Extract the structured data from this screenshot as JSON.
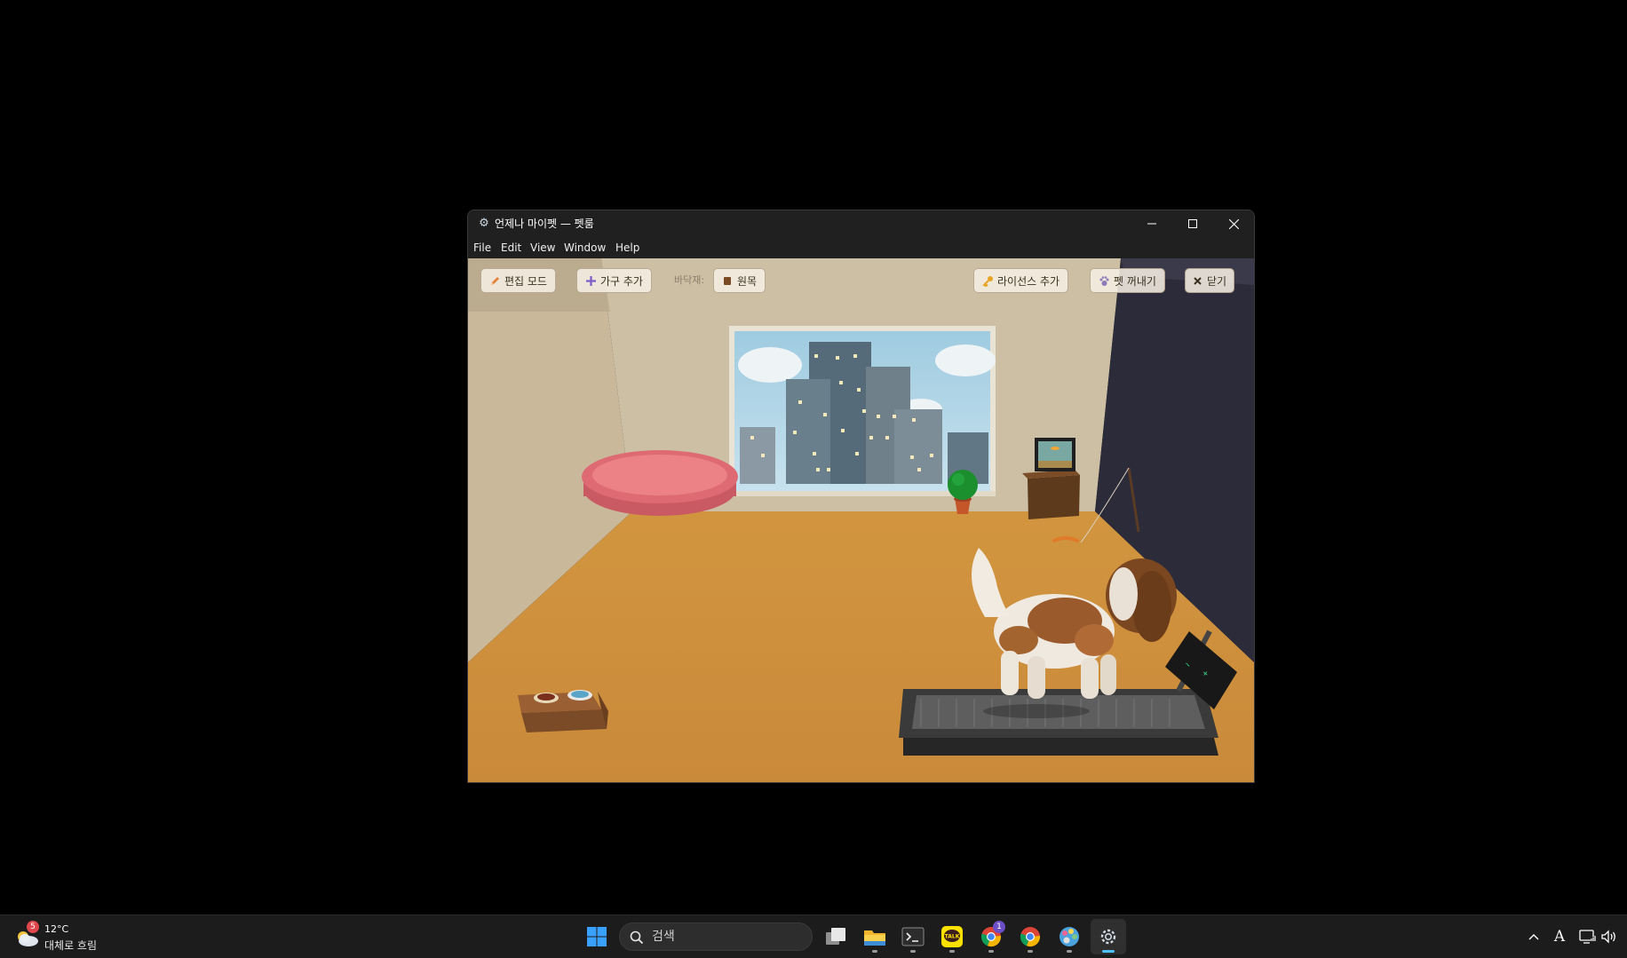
{
  "window": {
    "title": "언제나 마이펫 — 펫룸",
    "app_icon": "gear-icon",
    "controls": [
      "minimize-icon",
      "maximize-icon",
      "close-icon"
    ]
  },
  "menu": [
    "File",
    "Edit",
    "View",
    "Window",
    "Help"
  ],
  "toolbar": {
    "edit_mode": "편집 모드",
    "add_furniture": "가구 추가",
    "floor_label": "바닥재:",
    "floor_value": "원목",
    "add_license": "라이선스 추가",
    "take_out_pet": "펫 꺼내기",
    "close": "닫기"
  },
  "scene": {
    "objects": [
      "window-with-city-view",
      "round-pet-bed",
      "potted-plant",
      "aquarium-on-stand",
      "food-bowls",
      "treadmill",
      "shih-tzu-dog",
      "cat-toy-wand"
    ],
    "colors": {
      "floor": "#c98d3c",
      "wall": "#cdbfa4",
      "right_wall": "#2b2b3a"
    }
  },
  "taskbar": {
    "weather": {
      "badge": "5",
      "temp": "12°C",
      "condition": "대체로 흐림"
    },
    "search_placeholder": "검색",
    "chrome_badge": "1",
    "apps": [
      "start-icon",
      "task-view-icon",
      "file-explorer-icon",
      "terminal-icon",
      "kakaotalk-icon",
      "chrome-profile-icon",
      "chrome-icon",
      "palette-app-icon",
      "mypet-app-icon"
    ],
    "tray": [
      "chevron-up-icon",
      "ime-indicator",
      "network-icon",
      "volume-icon"
    ],
    "ime": "A"
  }
}
